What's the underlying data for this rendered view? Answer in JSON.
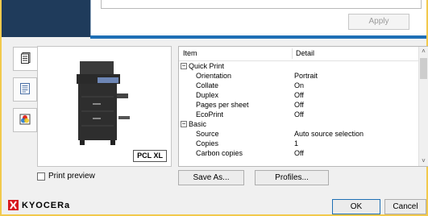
{
  "colors": {
    "brand_red": "#d71920",
    "accent_blue": "#1e6fb5"
  },
  "top_panel": {
    "apply_label": "Apply"
  },
  "side_tabs": [
    {
      "icon": "document-stack-icon"
    },
    {
      "icon": "page-layout-icon"
    },
    {
      "icon": "color-icon"
    }
  ],
  "preview": {
    "language_label": "PCL XL"
  },
  "print_preview": {
    "label": "Print preview",
    "checked": false
  },
  "detail_table": {
    "headers": {
      "item": "Item",
      "detail": "Detail"
    },
    "rows": [
      {
        "type": "category",
        "label": "Quick Print",
        "expanded": true
      },
      {
        "type": "item",
        "label": "Orientation",
        "value": "Portrait"
      },
      {
        "type": "item",
        "label": "Collate",
        "value": "On"
      },
      {
        "type": "item",
        "label": "Duplex",
        "value": "Off"
      },
      {
        "type": "item",
        "label": "Pages per sheet",
        "value": "Off"
      },
      {
        "type": "item",
        "label": "EcoPrint",
        "value": "Off"
      },
      {
        "type": "category",
        "label": "Basic",
        "expanded": true
      },
      {
        "type": "item",
        "label": "Source",
        "value": "Auto source selection"
      },
      {
        "type": "item",
        "label": "Copies",
        "value": "1"
      },
      {
        "type": "item",
        "label": "Carbon copies",
        "value": "Off"
      }
    ]
  },
  "buttons": {
    "save_as": "Save As...",
    "profiles": "Profiles...",
    "ok": "OK",
    "cancel": "Cancel"
  },
  "brand": {
    "name": "KYOCERa"
  }
}
